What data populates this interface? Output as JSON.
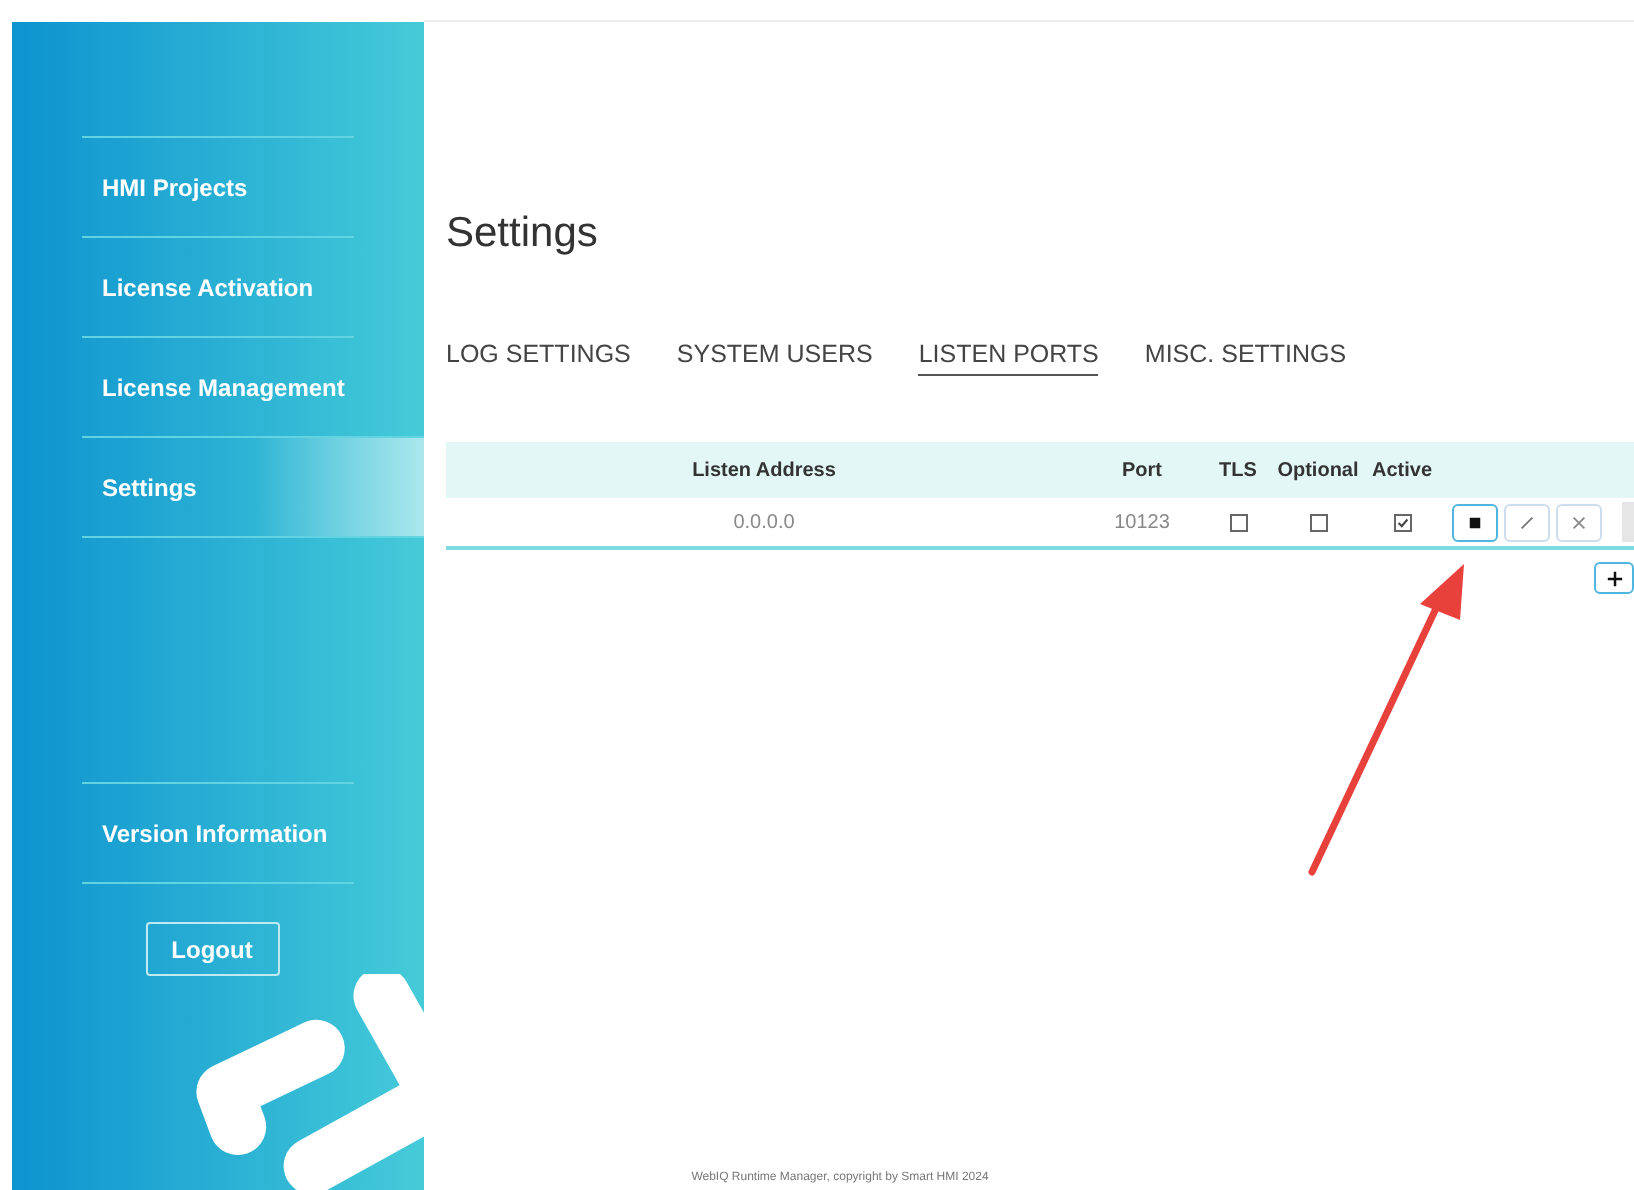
{
  "sidebar": {
    "items": [
      {
        "label": "HMI Projects",
        "selected": false
      },
      {
        "label": "License Activation",
        "selected": false
      },
      {
        "label": "License Management",
        "selected": false
      },
      {
        "label": "Settings",
        "selected": true
      }
    ],
    "bottom_items": [
      {
        "label": "Version Information"
      }
    ],
    "logout": "Logout"
  },
  "page": {
    "title": "Settings"
  },
  "tabs": [
    {
      "label": "LOG SETTINGS",
      "selected": false
    },
    {
      "label": "SYSTEM USERS",
      "selected": false
    },
    {
      "label": "LISTEN PORTS",
      "selected": true
    },
    {
      "label": "MISC. SETTINGS",
      "selected": false
    }
  ],
  "table": {
    "columns": [
      "Listen Address",
      "Port",
      "TLS",
      "Optional",
      "Active"
    ],
    "rows": [
      {
        "address": "0.0.0.0",
        "port": "10123",
        "tls": false,
        "optional": false,
        "active": true
      }
    ]
  },
  "footer": "WebIQ Runtime Manager, copyright by Smart HMI 2024"
}
